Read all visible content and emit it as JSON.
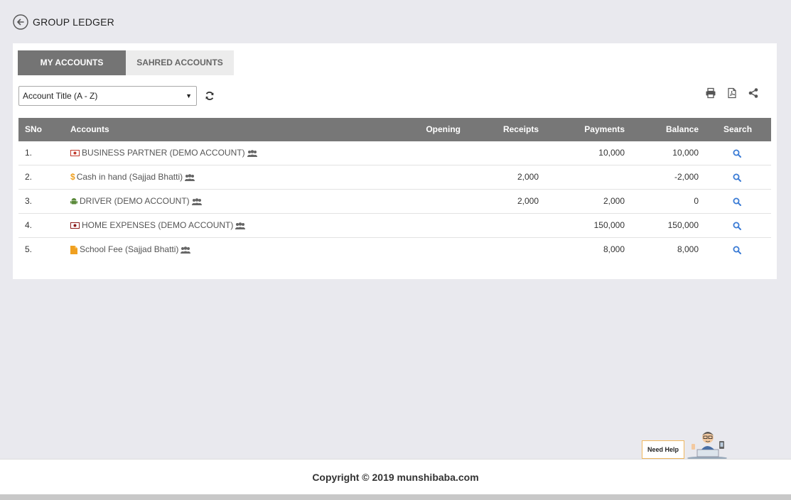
{
  "header": {
    "title": "GROUP LEDGER"
  },
  "tabs": [
    {
      "label": "MY ACCOUNTS",
      "active": true
    },
    {
      "label": "SAHRED ACCOUNTS",
      "active": false
    }
  ],
  "sort": {
    "selected": "Account Title (A - Z)"
  },
  "table": {
    "columns": [
      "SNo",
      "Accounts",
      "Opening",
      "Receipts",
      "Payments",
      "Balance",
      "Search"
    ],
    "rows": [
      {
        "sno": "1.",
        "account": "BUSINESS PARTNER (DEMO ACCOUNT)",
        "icon": "money-icon",
        "opening": "",
        "receipts": "",
        "payments": "10,000",
        "balance": "10,000"
      },
      {
        "sno": "2.",
        "account": "Cash in hand (Sajjad Bhatti)",
        "icon": "dollar-icon",
        "opening": "",
        "receipts": "2,000",
        "payments": "",
        "balance": "-2,000"
      },
      {
        "sno": "3.",
        "account": "DRIVER (DEMO ACCOUNT)",
        "icon": "android-icon",
        "opening": "",
        "receipts": "2,000",
        "payments": "2,000",
        "balance": "0"
      },
      {
        "sno": "4.",
        "account": "HOME EXPENSES (DEMO ACCOUNT)",
        "icon": "money-icon",
        "opening": "",
        "receipts": "",
        "payments": "150,000",
        "balance": "150,000"
      },
      {
        "sno": "5.",
        "account": "School Fee (Sajjad Bhatti)",
        "icon": "file-icon",
        "opening": "",
        "receipts": "",
        "payments": "8,000",
        "balance": "8,000"
      }
    ]
  },
  "help": {
    "label": "Need Help"
  },
  "footer": {
    "copyright": "Copyright © 2019 munshibaba.com"
  },
  "colors": {
    "header_bg": "#777777",
    "tab_active": "#747474",
    "search_icon": "#3a7bd5",
    "accent_orange": "#f0a020"
  }
}
